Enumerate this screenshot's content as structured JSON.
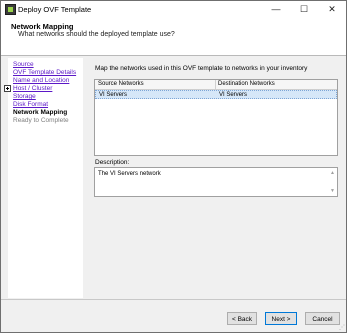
{
  "window": {
    "title": "Deploy OVF Template"
  },
  "header": {
    "title": "Network Mapping",
    "subtitle": "What networks should the deployed template use?"
  },
  "nav": {
    "items": [
      {
        "label": "Source",
        "state": "link"
      },
      {
        "label": "OVF Template Details",
        "state": "link"
      },
      {
        "label": "Name and Location",
        "state": "link"
      },
      {
        "label": "Host / Cluster",
        "state": "link"
      },
      {
        "label": "Storage",
        "state": "link"
      },
      {
        "label": "Disk Format",
        "state": "link"
      },
      {
        "label": "Network Mapping",
        "state": "current"
      },
      {
        "label": "Ready to Complete",
        "state": "future"
      }
    ]
  },
  "main": {
    "instruction": "Map the networks used in this OVF template to networks in your inventory",
    "grid": {
      "columns": [
        "Source Networks",
        "Destination Networks"
      ],
      "rows": [
        [
          "VI Servers",
          "VI Servers"
        ]
      ]
    },
    "description_label": "Description:",
    "description_text": "The VI Servers network"
  },
  "buttons": {
    "back": "< Back",
    "next": "Next >",
    "cancel": "Cancel"
  },
  "colors": {
    "link": "#5b17c7",
    "selection": "#d6e7f8",
    "accent": "#0078d7"
  }
}
